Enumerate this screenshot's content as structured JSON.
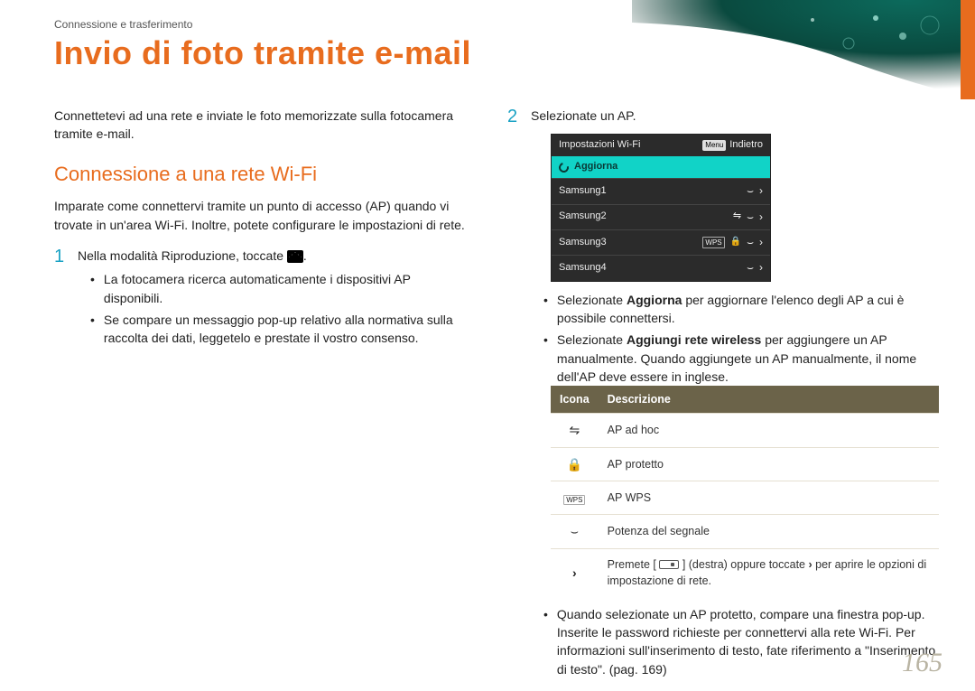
{
  "breadcrumb": "Connessione e trasferimento",
  "title": "Invio di foto tramite e-mail",
  "intro": "Connettetevi ad una rete e inviate le foto memorizzate sulla fotocamera tramite e-mail.",
  "section_heading": "Connessione a una rete Wi-Fi",
  "section_intro": "Imparate come connettervi tramite un punto di accesso (AP) quando vi trovate in un'area Wi-Fi. Inoltre, potete configurare le impostazioni di rete.",
  "steps": [
    {
      "num": "1",
      "text_a": "Nella modalità Riproduzione, toccate ",
      "text_b": ".",
      "bullets": [
        "La fotocamera ricerca automaticamente i dispositivi AP disponibili.",
        "Se compare un messaggio pop-up relativo alla normativa sulla raccolta dei dati, leggetelo e prestate il vostro consenso."
      ]
    },
    {
      "num": "2",
      "text": "Selezionate un AP.",
      "bullets": [
        {
          "pre": "Selezionate ",
          "bold": "Aggiorna",
          "post": " per aggiornare l'elenco degli AP a cui è possibile connettersi."
        },
        {
          "pre": "Selezionate ",
          "bold": "Aggiungi rete wireless",
          "post": " per aggiungere un AP manualmente. Quando aggiungete un AP manualmente, il nome dell'AP deve essere in inglese."
        },
        "Quando selezionate un AP protetto, compare una finestra pop-up. Inserite le password richieste per connettervi alla rete Wi-Fi. Per informazioni sull'inserimento di testo, fate riferimento a \"Inserimento di testo\". (pag. 169)"
      ]
    }
  ],
  "wifi_panel": {
    "title": "Impostazioni Wi-Fi",
    "menu_chip": "Menu",
    "back": "Indietro",
    "refresh": "Aggiorna",
    "wps_chip": "WPS",
    "rows": [
      {
        "ssid": "Samsung1"
      },
      {
        "ssid": "Samsung2"
      },
      {
        "ssid": "Samsung3"
      },
      {
        "ssid": "Samsung4"
      }
    ]
  },
  "icon_table": {
    "headers": [
      "Icona",
      "Descrizione"
    ],
    "rows": [
      {
        "desc": "AP ad hoc"
      },
      {
        "desc": "AP protetto"
      },
      {
        "desc": "AP WPS"
      },
      {
        "desc": "Potenza del segnale"
      },
      {
        "pre": "Premete [",
        "mid": "] (destra) oppure toccate ",
        "post": " per aprire le opzioni di impostazione di rete."
      }
    ]
  },
  "page_number": "165"
}
